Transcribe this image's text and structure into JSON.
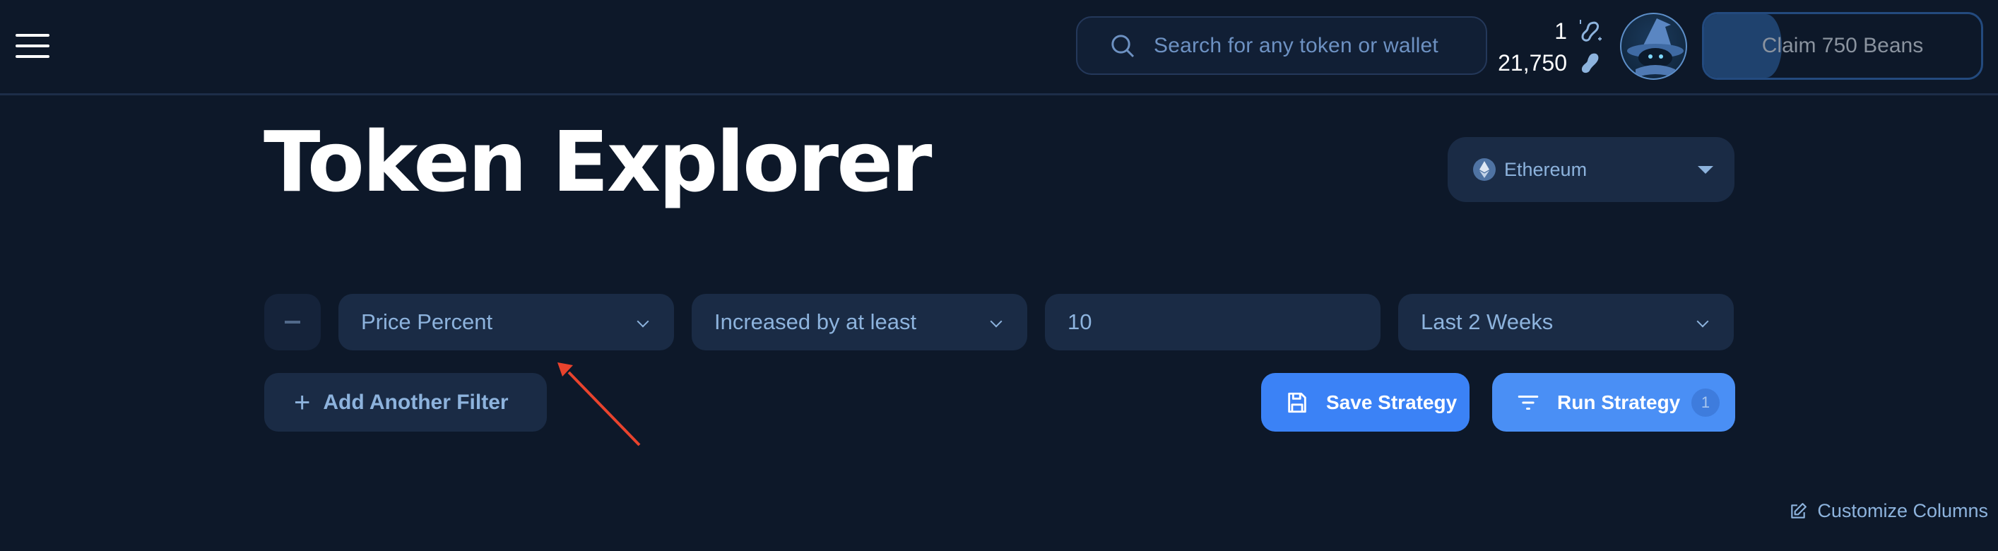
{
  "header": {
    "search": {
      "placeholder": "Search for any token or wallet",
      "icon": "search-icon"
    },
    "counters": {
      "sparkle_beans": "1",
      "beans": "21,750"
    },
    "claim_button": {
      "label": "Claim 750 Beans",
      "progress_fraction": 0.28
    }
  },
  "page": {
    "title": "Token Explorer",
    "chain_select": {
      "value": "Ethereum",
      "icon": "ethereum-icon"
    }
  },
  "filter": {
    "metric": "Price Percent",
    "condition": "Increased by at least",
    "value": "10",
    "period": "Last 2 Weeks"
  },
  "actions": {
    "add_filter": "Add Another Filter",
    "add_filter_icon": "+",
    "save_strategy": "Save Strategy",
    "run_strategy": "Run Strategy",
    "run_strategy_badge": "1",
    "customize_columns": "Customize Columns"
  },
  "colors": {
    "background": "#0d1829",
    "panel": "#1a2b45",
    "accent": "#3b82f6",
    "text_muted": "#8db3dd",
    "annotation": "#e8432d"
  }
}
